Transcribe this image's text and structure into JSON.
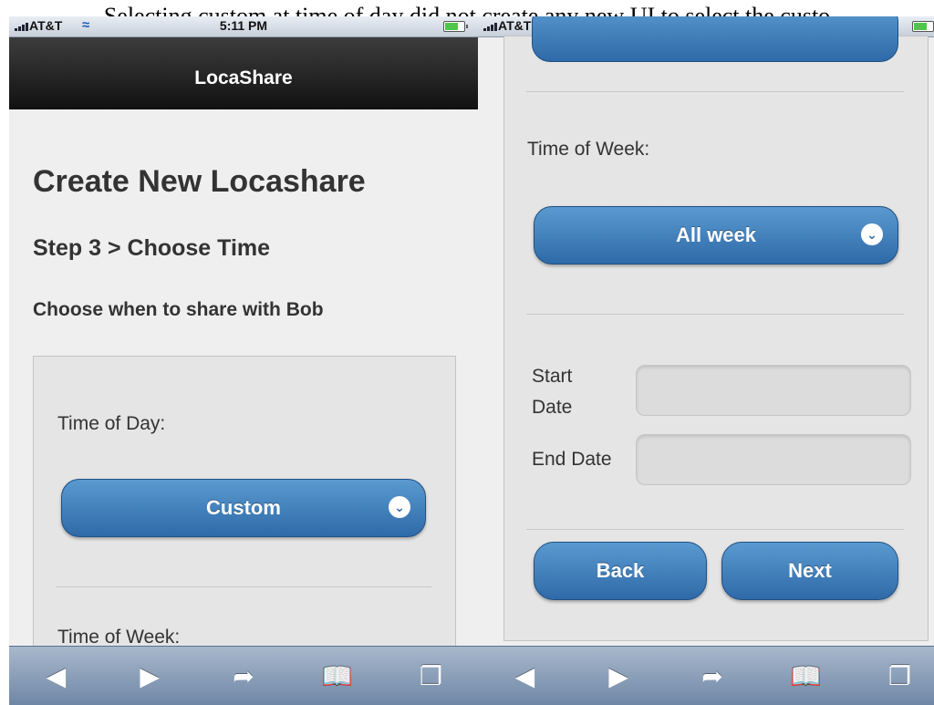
{
  "caption": "Selecting custom at time of day did not create any new UI to select the custo",
  "status": {
    "carrier": "AT&T",
    "time": "5:11 PM"
  },
  "left": {
    "header_title": "LocaShare",
    "page_title": "Create New Locashare",
    "step_title": "Step 3 > Choose Time",
    "subtitle": "Choose when to share with Bob",
    "time_of_day_label": "Time of Day:",
    "time_of_day_value": "Custom",
    "time_of_week_label": "Time of Week:"
  },
  "right": {
    "time_of_week_label": "Time of Week:",
    "time_of_week_value": "All week",
    "start_date_label_1": "Start",
    "start_date_label_2": "Date",
    "end_date_label": "End Date",
    "back_label": "Back",
    "next_label": "Next"
  },
  "toolbar": {
    "icons": [
      "back-arrow-icon",
      "forward-arrow-icon",
      "share-icon",
      "bookmarks-icon",
      "tabs-icon"
    ]
  }
}
